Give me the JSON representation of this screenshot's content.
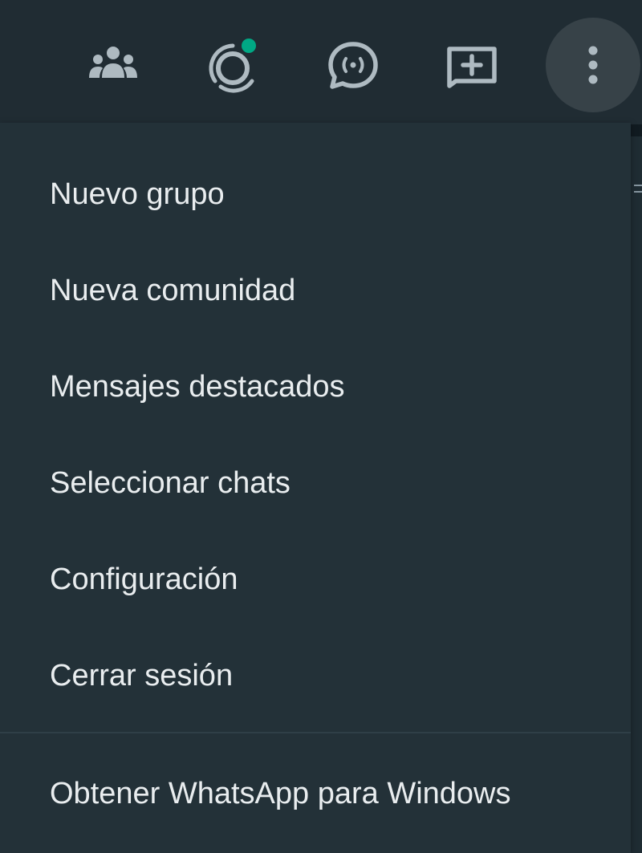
{
  "header": {
    "icons": [
      {
        "name": "communities-icon",
        "label": "Comunidades"
      },
      {
        "name": "status-icon",
        "label": "Estados",
        "badge_color": "#00a884"
      },
      {
        "name": "channels-icon",
        "label": "Canales"
      },
      {
        "name": "new-chat-icon",
        "label": "Nuevo chat"
      },
      {
        "name": "menu-icon",
        "label": "Menú",
        "active": true
      }
    ]
  },
  "menu": {
    "items": [
      {
        "label": "Nuevo grupo"
      },
      {
        "label": "Nueva comunidad"
      },
      {
        "label": "Mensajes destacados"
      },
      {
        "label": "Seleccionar chats"
      },
      {
        "label": "Configuración"
      },
      {
        "label": "Cerrar sesión"
      }
    ],
    "footer_item": {
      "label": "Obtener WhatsApp para Windows"
    }
  },
  "colors": {
    "header_bg": "#202c33",
    "menu_bg": "#233138",
    "text": "#e9edef",
    "icon": "#aebac1",
    "accent": "#00a884"
  }
}
